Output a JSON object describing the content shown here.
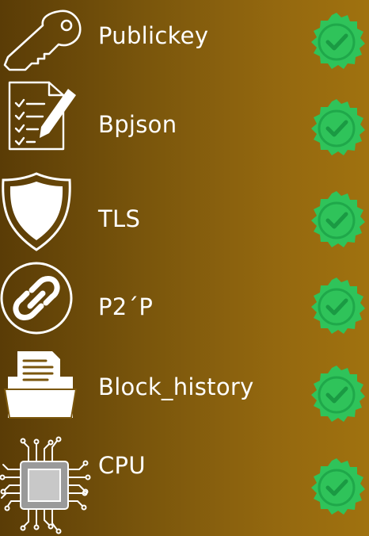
{
  "items": [
    {
      "label": "Publickey",
      "icon": "key-icon",
      "status": "verified",
      "status_icon": "check-badge-icon"
    },
    {
      "label": "Bpjson",
      "icon": "checklist-document-icon",
      "status": "verified",
      "status_icon": "check-badge-icon"
    },
    {
      "label": "TLS",
      "icon": "shield-icon",
      "status": "verified",
      "status_icon": "check-badge-icon"
    },
    {
      "label": "P2´P",
      "icon": "link-icon",
      "status": "verified",
      "status_icon": "check-badge-icon"
    },
    {
      "label": "Block_history",
      "icon": "document-folder-icon",
      "status": "verified",
      "status_icon": "check-badge-icon"
    },
    {
      "label": "CPU",
      "icon": "cpu-chip-icon",
      "status": "verified",
      "status_icon": "check-badge-icon"
    }
  ],
  "colors": {
    "background_start": "#5a3c06",
    "background_end": "#a0720f",
    "icon_stroke": "#ffffff",
    "check_badge": "#2fc35a",
    "check_badge_inner": "#1fa84a",
    "chip_frame": "#9a9a9a"
  }
}
